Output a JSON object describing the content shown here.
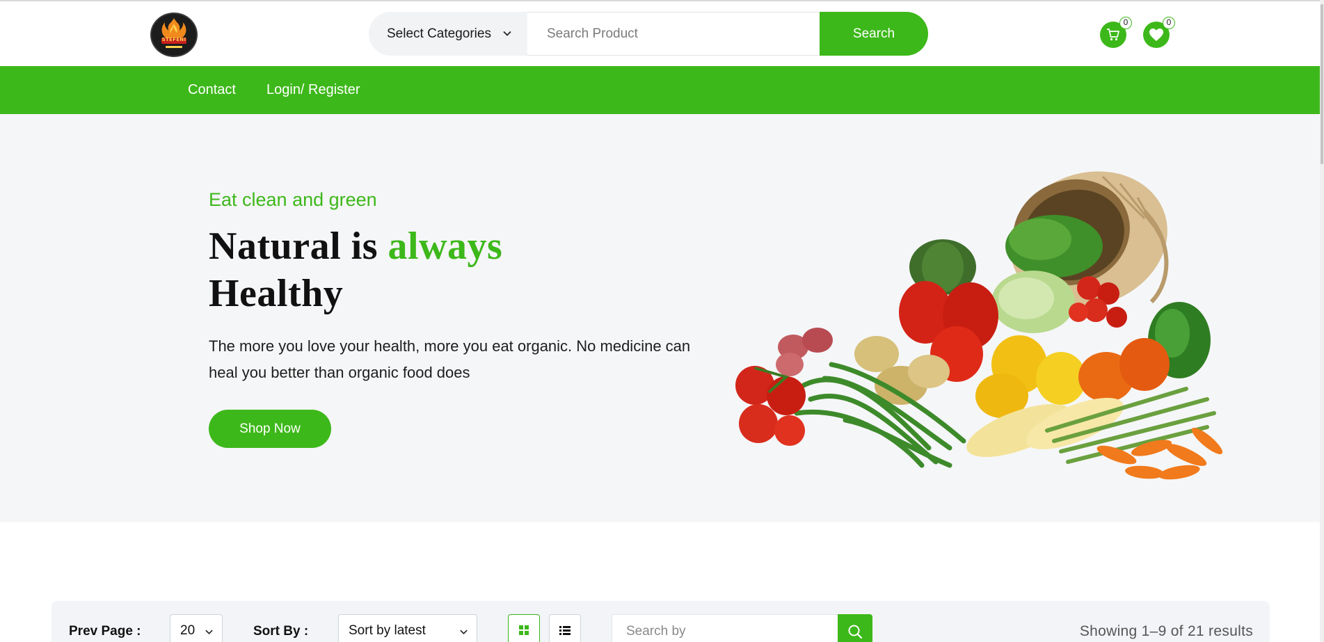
{
  "header": {
    "logo": {
      "text": "STEFENI",
      "alt": "logo-icon"
    },
    "category_select": {
      "label": "Select Categories"
    },
    "search": {
      "placeholder": "Search Product",
      "button_label": "Search"
    },
    "cart": {
      "count": "0",
      "icon": "cart-icon"
    },
    "wishlist": {
      "count": "0",
      "icon": "heart-icon"
    }
  },
  "nav": {
    "items": [
      {
        "label": "Contact"
      },
      {
        "label": "Login/ Register"
      }
    ]
  },
  "hero": {
    "eyebrow": "Eat clean and green",
    "title_part1": "Natural is ",
    "title_accent": "always",
    "title_part2": "Healthy",
    "description": "The more you love your health, more you eat organic. No medicine can heal you better than organic food does",
    "cta_label": "Shop Now"
  },
  "toolbar": {
    "per_page_label": "Prev Page :",
    "per_page_value": "20",
    "sort_label": "Sort By :",
    "sort_value": "Sort by latest",
    "search_placeholder": "Search by",
    "results_text": "Showing 1–9 of 21 results"
  },
  "colors": {
    "brand_green": "#3db81a",
    "hero_bg": "#f5f6f8",
    "toolbar_bg": "#f2f4f7"
  }
}
